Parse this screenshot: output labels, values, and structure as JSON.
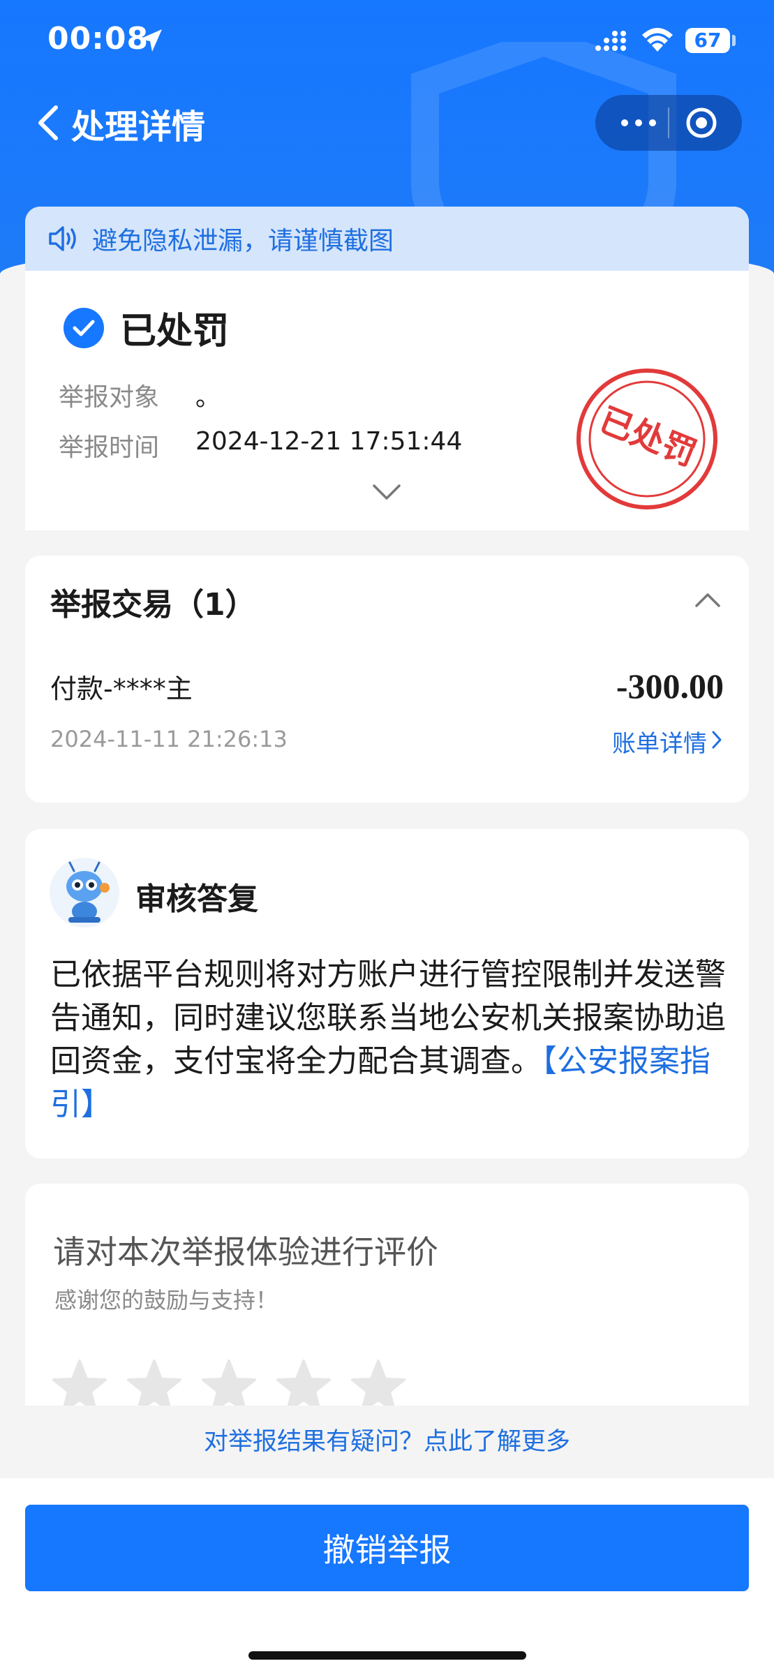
{
  "status_bar": {
    "time": "00:08",
    "battery": "67"
  },
  "nav": {
    "title": "处理详情"
  },
  "notice": {
    "text": "避免隐私泄漏，请谨慎截图"
  },
  "status": {
    "text": "已处罚",
    "stamp_text": "已处罚",
    "fields": [
      {
        "label": "举报对象",
        "value": "。"
      },
      {
        "label": "举报时间",
        "value": "2024-12-21 17:51:44"
      }
    ]
  },
  "transactions": {
    "title": "举报交易（1）",
    "items": [
      {
        "name": "付款-****主",
        "amount": "-300.00",
        "time": "2024-11-11 21:26:13",
        "link": "账单详情"
      }
    ]
  },
  "review": {
    "title": "审核答复",
    "body": "已依据平台规则将对方账户进行管控限制并发送警告通知，同时建议您联系当地公安机关报案协助追回资金，支付宝将全力配合其调查。",
    "link": "【公安报案指引】"
  },
  "rating": {
    "title": "请对本次举报体验进行评价",
    "subtitle": "感谢您的鼓励与支持！",
    "stars_max": 5,
    "stars_selected": 0
  },
  "faq": {
    "text": "对举报结果有疑问？点此了解更多"
  },
  "actions": {
    "cancel_label": "撤销举报"
  },
  "colors": {
    "primary": "#1677ff",
    "link": "#1e6fe0",
    "stamp": "#e23a3a"
  }
}
